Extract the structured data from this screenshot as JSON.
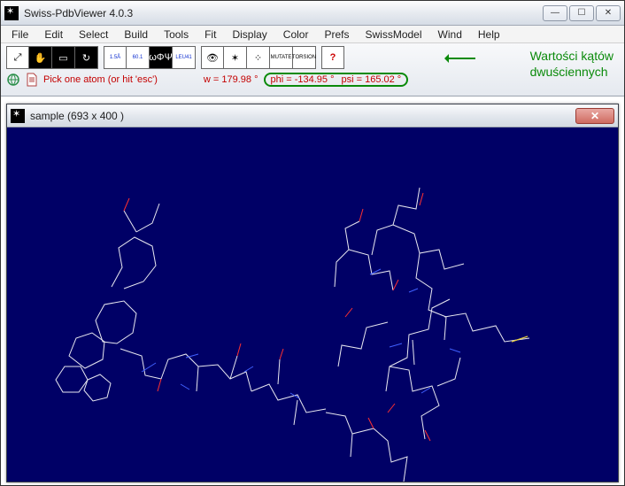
{
  "app": {
    "title": "Swiss-PdbViewer 4.0.3"
  },
  "menu": {
    "items": [
      "File",
      "Edit",
      "Select",
      "Build",
      "Tools",
      "Fit",
      "Display",
      "Color",
      "Prefs",
      "SwissModel",
      "Wind",
      "Help"
    ]
  },
  "toolbar": {
    "buttons": [
      {
        "name": "expand-icon",
        "label": "⤢",
        "cls": ""
      },
      {
        "name": "pan-hand-icon",
        "label": "✋",
        "cls": "inv"
      },
      {
        "name": "depth-cue-icon",
        "label": "▭",
        "cls": "inv"
      },
      {
        "name": "stereo-icon",
        "label": "↻",
        "cls": "inv"
      },
      {
        "name": "dist-1-5a-icon",
        "label": "1.5Å",
        "cls": "blue"
      },
      {
        "name": "angle-60-1-icon",
        "label": "60.1",
        "cls": "blue"
      },
      {
        "name": "omega-phi-psi-icon",
        "label": "ωΦΨ",
        "cls": "inv"
      },
      {
        "name": "leu41-icon",
        "label": "LEU41",
        "cls": "blue"
      },
      {
        "name": "eye-1a-icon",
        "label": "👁",
        "cls": ""
      },
      {
        "name": "eye-star-icon",
        "label": "✶",
        "cls": ""
      },
      {
        "name": "dots-icon",
        "label": "⁘",
        "cls": ""
      },
      {
        "name": "mutate-icon",
        "label": "MUTATE",
        "cls": ""
      },
      {
        "name": "torsion-icon",
        "label": "TORSION",
        "cls": ""
      },
      {
        "name": "help-icon",
        "label": "?",
        "cls": "red"
      }
    ]
  },
  "status": {
    "hint": "Pick one atom (or hit 'esc')",
    "w_label": "w = 179.98 °",
    "phi_label": "phi = -134.95 °",
    "psi_label": "psi = 165.02 °"
  },
  "annotation": {
    "line1": "Wartości kątów",
    "line2": "dwuściennych"
  },
  "child": {
    "title": "sample  (693 x 400 )"
  }
}
